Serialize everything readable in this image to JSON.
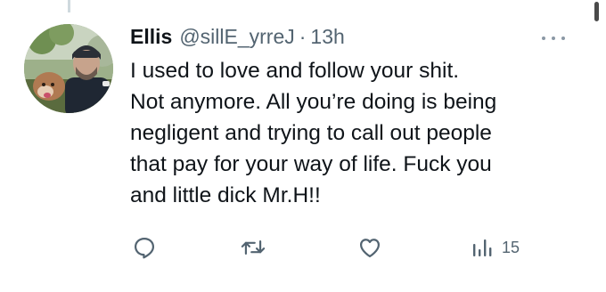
{
  "tweet": {
    "author_name": "Ellis",
    "author_handle": "@sillE_yrreJ",
    "separator": "·",
    "timestamp": "13h",
    "text": "I used to love and follow your shit.\nNot anymore. All you’re doing is being\nnegligent and trying to call out people\nthat pay for your way of life. Fuck you\nand little dick Mr.H!!",
    "views_count": "15"
  },
  "icons": {
    "avatar": "profile-photo",
    "more": "more-horizontal-icon",
    "reply": "reply-icon",
    "retweet": "retweet-icon",
    "like": "heart-icon",
    "views": "views-chart-icon"
  },
  "colors": {
    "text_primary": "#0f1419",
    "text_secondary": "#536471",
    "background": "#ffffff"
  }
}
